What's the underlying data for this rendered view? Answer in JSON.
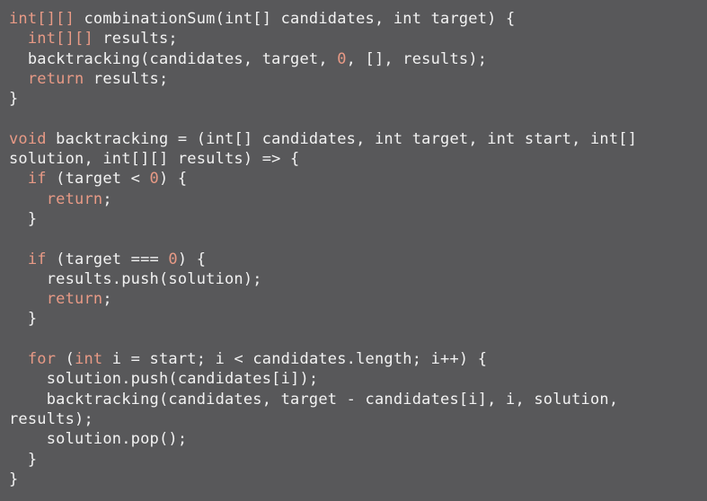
{
  "editor": {
    "lines": [
      [
        {
          "t": "int[][]",
          "c": "kw"
        },
        {
          "t": " combinationSum(int[] candidates, int target) {"
        }
      ],
      [
        {
          "t": "  "
        },
        {
          "t": "int[][]",
          "c": "kw"
        },
        {
          "t": " results;"
        }
      ],
      [
        {
          "t": "  backtracking(candidates, target, "
        },
        {
          "t": "0",
          "c": "num"
        },
        {
          "t": ", [], results);"
        }
      ],
      [
        {
          "t": "  "
        },
        {
          "t": "return",
          "c": "kw"
        },
        {
          "t": " results;"
        }
      ],
      [
        {
          "t": "}"
        }
      ],
      [
        {
          "t": ""
        }
      ],
      [
        {
          "t": "void",
          "c": "kw"
        },
        {
          "t": " backtracking = (int[] candidates, int target, int start, int[]"
        }
      ],
      [
        {
          "t": "solution, int[][] results) => {"
        }
      ],
      [
        {
          "t": "  "
        },
        {
          "t": "if",
          "c": "kw"
        },
        {
          "t": " (target < "
        },
        {
          "t": "0",
          "c": "num"
        },
        {
          "t": ") {"
        }
      ],
      [
        {
          "t": "    "
        },
        {
          "t": "return",
          "c": "kw"
        },
        {
          "t": ";"
        }
      ],
      [
        {
          "t": "  }"
        }
      ],
      [
        {
          "t": ""
        }
      ],
      [
        {
          "t": "  "
        },
        {
          "t": "if",
          "c": "kw"
        },
        {
          "t": " (target === "
        },
        {
          "t": "0",
          "c": "num"
        },
        {
          "t": ") {"
        }
      ],
      [
        {
          "t": "    results.push(solution);"
        }
      ],
      [
        {
          "t": "    "
        },
        {
          "t": "return",
          "c": "kw"
        },
        {
          "t": ";"
        }
      ],
      [
        {
          "t": "  }"
        }
      ],
      [
        {
          "t": ""
        }
      ],
      [
        {
          "t": "  "
        },
        {
          "t": "for",
          "c": "kw"
        },
        {
          "t": " ("
        },
        {
          "t": "int",
          "c": "kw"
        },
        {
          "t": " i = start; i < candidates.length; i++) {"
        }
      ],
      [
        {
          "t": "    solution.push(candidates[i]);"
        }
      ],
      [
        {
          "t": "    backtracking(candidates, target - candidates[i], i, solution,"
        }
      ],
      [
        {
          "t": "results);"
        }
      ],
      [
        {
          "t": "    solution.pop();"
        }
      ],
      [
        {
          "t": "  }"
        }
      ],
      [
        {
          "t": "}"
        }
      ]
    ],
    "colors": {
      "background": "#58585a",
      "text": "#f2f2f2",
      "keyword": "#e89a86"
    }
  }
}
